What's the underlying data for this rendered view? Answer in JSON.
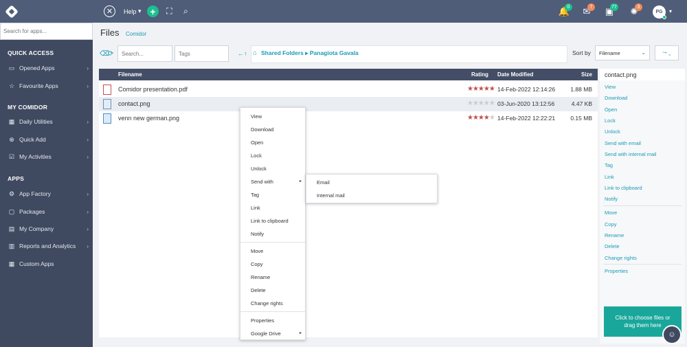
{
  "topbar": {
    "help_label": "Help",
    "help_caret": "▾",
    "close_glyph": "✕",
    "plus_glyph": "+",
    "expand_glyph": "⛶",
    "search_glyph": "⌕",
    "notifications": [
      {
        "icon": "bell-icon",
        "glyph": "🔔",
        "count": "0",
        "color": "#1cbf8f"
      },
      {
        "icon": "mail-icon",
        "glyph": "✉",
        "count": "7",
        "color": "#f08a5d"
      },
      {
        "icon": "calendar-icon",
        "glyph": "▣",
        "count": "77",
        "color": "#1cbf8f"
      },
      {
        "icon": "sun-icon",
        "glyph": "✺",
        "count": "3",
        "color": "#f08a5d"
      }
    ],
    "avatar_initials": "PG",
    "avatar_caret": "▾"
  },
  "sidebar": {
    "search_placeholder": "Search for apps...",
    "sections": [
      {
        "title": "QUICK ACCESS",
        "items": [
          {
            "label": "Opened Apps",
            "icon": "folder-icon",
            "glyph": "▭",
            "chevron": "›"
          },
          {
            "label": "Favourite Apps",
            "icon": "star-icon",
            "glyph": "☆",
            "chevron": "›"
          }
        ]
      },
      {
        "title": "MY COMIDOR",
        "items": [
          {
            "label": "Daily Utilities",
            "icon": "grid-icon",
            "glyph": "▦",
            "chevron": "›"
          },
          {
            "label": "Quick Add",
            "icon": "plus-circle-icon",
            "glyph": "⊕",
            "chevron": "›"
          },
          {
            "label": "My Activities",
            "icon": "checkbox-icon",
            "glyph": "☑",
            "chevron": "›"
          }
        ]
      },
      {
        "title": "APPS",
        "items": [
          {
            "label": "App Factory",
            "icon": "gear-icon",
            "glyph": "⚙",
            "chevron": "›"
          },
          {
            "label": "Packages",
            "icon": "package-icon",
            "glyph": "▢",
            "chevron": "›"
          },
          {
            "label": "My Company",
            "icon": "company-icon",
            "glyph": "▤",
            "chevron": "›"
          },
          {
            "label": "Reports and Analytics",
            "icon": "chart-icon",
            "glyph": "▥",
            "chevron": "›"
          },
          {
            "label": "Custom Apps",
            "icon": "apps-icon",
            "glyph": "▦",
            "chevron": ""
          }
        ]
      }
    ]
  },
  "main": {
    "title": "Files",
    "subtitle": "Comidor",
    "search_placeholder": "Search...",
    "tags_placeholder": "Tags",
    "path": "Shared Folders ▸ Panagiota Gavala",
    "home_glyph": "⌂",
    "nav_glyph": "←↑",
    "reset_glyph": "⌫",
    "refresh_glyph": "⟳",
    "sort_label": "Sort by",
    "sort_value": "Filename",
    "sort_chevron": "⌄",
    "sort_dir_glyph": "⤳ ⌄",
    "columns": {
      "filename": "Filename",
      "rating": "Rating",
      "modified": "Date Modified",
      "size": "Size"
    },
    "files": [
      {
        "name": "Comidor presentation.pdf",
        "stars": "★★★★★",
        "empty_stars": "",
        "date": "14-Feb-2022 12:14:26",
        "size": "1.88 MB",
        "icon": "pdf-icon"
      },
      {
        "name": "contact.png",
        "stars": "",
        "empty_stars": "★★★★★",
        "date": "03-Jun-2020 13:12:56",
        "size": "4.47 KB",
        "icon": "image-icon"
      },
      {
        "name": "venn new german.png",
        "stars": "★★★★",
        "empty_stars": "★",
        "date": "14-Feb-2022 12:22:21",
        "size": "0.15 MB",
        "icon": "image-icon"
      }
    ]
  },
  "right_panel": {
    "title": "contact.png",
    "group1": [
      "View",
      "Download",
      "Open",
      "Lock",
      "Unlock",
      "Send with email",
      "Send with internal mail",
      "Tag",
      "Link",
      "Link to clipboard",
      "Notify"
    ],
    "group2": [
      "Move",
      "Copy",
      "Rename",
      "Delete",
      "Change rights"
    ],
    "group3": [
      "Properties"
    ],
    "upload_text": "Click to choose files or drag them here",
    "chatbot_glyph": "☺"
  },
  "context_menu": {
    "group1": [
      "View",
      "Download",
      "Open",
      "Lock",
      "Unlock",
      "Send with",
      "Tag",
      "Link",
      "Link to clipboard",
      "Notify"
    ],
    "group2": [
      "Move",
      "Copy",
      "Rename",
      "Delete",
      "Change rights"
    ],
    "group3": [
      "Properties",
      "Google Drive"
    ],
    "arrow_glyph": "▸",
    "submenu": [
      "Email",
      "Internal mail"
    ]
  },
  "colors": {
    "accent": "#1a9bb5",
    "topbar": "#4f5d79",
    "sidebar": "#3f4960",
    "star_filled": "#c0504d",
    "star_empty": "#cccccc",
    "upload": "#1aa79b"
  }
}
